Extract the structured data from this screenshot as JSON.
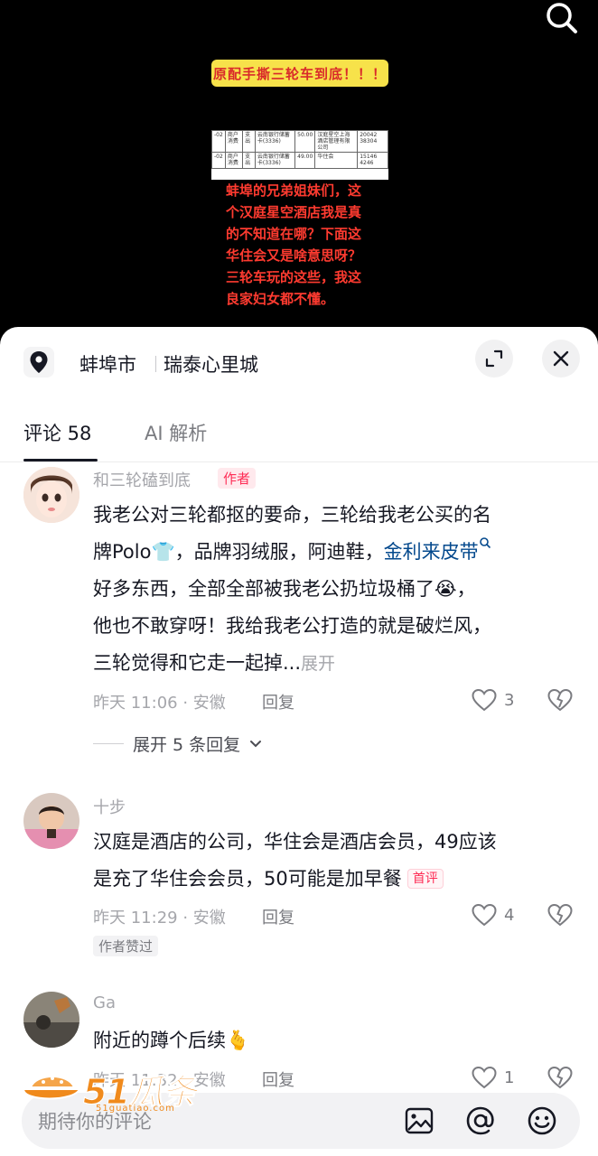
{
  "video": {
    "banner_text": "原配手撕三轮车到底！！！",
    "doc_rows": [
      [
        "-02",
        "商户消费",
        "支出",
        "云南银行储蓄卡(3336)",
        "50.00",
        "汉庭星空上海酒店管理有限公司",
        "20042 38304"
      ],
      [
        "-02",
        "商户消费",
        "支出",
        "云南银行储蓄卡(3336)",
        "49.00",
        "华住会",
        "15146 4246"
      ]
    ],
    "overlay_lines": [
      "蚌埠的兄弟姐妹们，这",
      "个汉庭星空酒店我是真",
      "的不知道在哪？下面这",
      "华住会又是啥意思呀？",
      "三轮车玩的这些，我这",
      "良家妇女都不懂。"
    ]
  },
  "location": {
    "city": "蚌埠市",
    "place": "瑞泰心里城"
  },
  "tabs": {
    "comments": "评论 58",
    "ai": "AI 解析"
  },
  "comments": [
    {
      "name": "和三轮磕到底",
      "author_tag": "作者",
      "lines": [
        "我老公对三轮都抠的要命，三轮给我老公买的名",
        "牌Polo👕，品牌羽绒服，阿迪鞋，",
        "好多东西，全部全部被我老公扔垃圾桶了😭，",
        "他也不敢穿呀！我给我老公打造的就是破烂风，",
        "三轮觉得和它走一起掉..."
      ],
      "link_text": "金利来皮带",
      "more": "展开",
      "meta": "昨天 11:06 · 安徽",
      "reply": "回复",
      "likes": "3",
      "expand_replies": "展开 5 条回复"
    },
    {
      "name": "十步",
      "lines": [
        "汉庭是酒店的公司，华住会是酒店会员，49应该",
        "是充了华住会会员，50可能是加早餐"
      ],
      "first_tag": "首评",
      "meta": "昨天 11:29 · 安徽",
      "reply": "回复",
      "likes": "4",
      "liked_tag": "作者赞过"
    },
    {
      "name": "Ga",
      "lines": [
        "附近的蹲个后续🫰"
      ],
      "meta": "昨天 11:32 · 安徽",
      "reply": "回复",
      "likes": "1"
    }
  ],
  "input": {
    "placeholder": "期待你的评论"
  },
  "watermark": {
    "text": "51瓜条",
    "sub": "51guatiao.com"
  },
  "colors": {
    "accent": "#fe2c55",
    "link": "#04498d",
    "overlay_red": "#ff3b30",
    "banner_yellow": "#f7e24a",
    "watermark": "#f08a1c"
  }
}
